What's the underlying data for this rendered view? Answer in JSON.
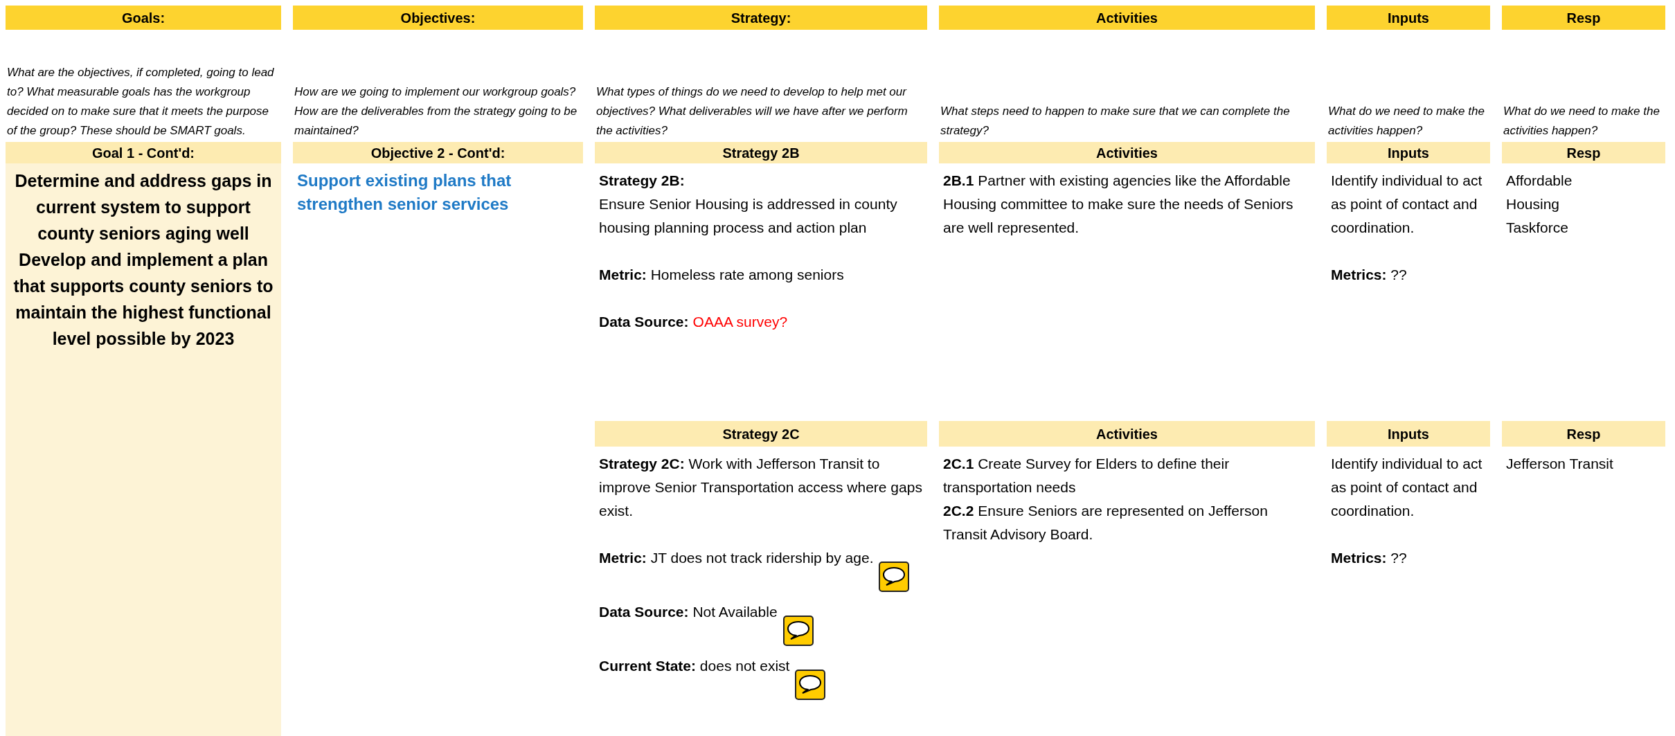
{
  "columns": [
    {
      "title": "Goals:",
      "description": "What are the objectives, if completed, going to lead to? What measurable goals has the workgroup decided on to make sure that it meets the purpose of the group? These should be SMART goals."
    },
    {
      "title": "Objectives:",
      "description": "How are we going to implement our workgroup goals? How are the deliverables from the strategy going to be maintained?"
    },
    {
      "title": "Strategy:",
      "description": "What types of things do we need to develop to help met our objectives? What deliverables will we have after we perform the activities?"
    },
    {
      "title": "Activities",
      "description": "What steps need to happen to make sure that we can complete the strategy?"
    },
    {
      "title": "Inputs",
      "description": "What do we need to make the activities happen?"
    },
    {
      "title": "Resp",
      "description": "What do we need to make the activities happen?"
    }
  ],
  "goal": {
    "heading": "Goal 1 - Cont'd:",
    "text": "Determine and address gaps in current system to support county seniors aging well Develop and implement a plan that supports county seniors to maintain the highest functional level possible by 2023"
  },
  "objective": {
    "heading": "Objective 2 - Cont'd:",
    "text": "Support existing plans that strengthen senior services"
  },
  "strategies": [
    {
      "headings": [
        "Strategy 2B",
        "Activities",
        "Inputs",
        "Resp"
      ],
      "cells": [
        [
          {
            "text": "**Strategy 2B:**\nEnsure Senior Housing is addressed in county housing planning process and action plan"
          },
          {
            "text": "**Metric:** Homeless rate among seniors"
          },
          {
            "text": "**Data Source:**",
            "note": "OAAA survey?"
          }
        ],
        [
          {
            "text": "**2B.1**  Partner with existing agencies like the Affordable Housing committee to make sure the needs of Seniors are well represented."
          }
        ],
        [
          {
            "text": "Identify individual to act as point of contact and coordination."
          },
          {
            "text": "**Metrics:**  ??"
          }
        ],
        [
          {
            "text": "Affordable\nHousing\nTaskforce"
          }
        ]
      ]
    },
    {
      "headings": [
        "Strategy 2C",
        "Activities",
        "Inputs",
        "Resp"
      ],
      "cells": [
        [
          {
            "text": "**Strategy 2C:**  Work with Jefferson Transit to improve Senior Transportation access where gaps exist."
          },
          {
            "text": "**Metric:** JT does not track ridership by age.",
            "comment": true
          },
          {
            "text": "**Data Source:** Not Available",
            "comment": true
          },
          {
            "text": "**Current State:** does not exist",
            "comment": true
          }
        ],
        [
          {
            "text": "**2C.1**  Create Survey for Elders to define their transportation needs\n**2C.2** Ensure Seniors are represented on Jefferson Transit Advisory Board."
          }
        ],
        [
          {
            "text": "Identify individual to act as point of contact and coordination."
          },
          {
            "text": "**Metrics:**  ??"
          }
        ],
        [
          {
            "text": "Jefferson Transit"
          }
        ]
      ]
    }
  ]
}
